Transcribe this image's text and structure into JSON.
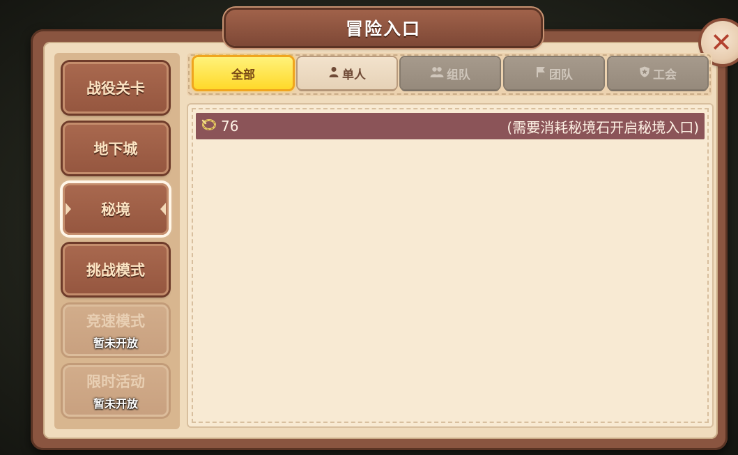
{
  "window": {
    "title": "冒险入口",
    "close_icon": "close-icon"
  },
  "sidebar": {
    "items": [
      {
        "label": "战役关卡",
        "state": "normal"
      },
      {
        "label": "地下城",
        "state": "normal"
      },
      {
        "label": "秘境",
        "state": "selected"
      },
      {
        "label": "挑战模式",
        "state": "normal"
      },
      {
        "label": "竞速模式",
        "sub": "暂未开放",
        "state": "disabled"
      },
      {
        "label": "限时活动",
        "sub": "暂未开放",
        "state": "disabled"
      }
    ]
  },
  "tabs": [
    {
      "label": "全部",
      "icon": "",
      "state": "selected"
    },
    {
      "label": "单人",
      "icon": "person-icon",
      "state": "normal"
    },
    {
      "label": "组队",
      "icon": "group-icon",
      "state": "disabled"
    },
    {
      "label": "团队",
      "icon": "flag-icon",
      "state": "disabled"
    },
    {
      "label": "工会",
      "icon": "shield-icon",
      "state": "disabled"
    }
  ],
  "entries": [
    {
      "icon": "ring-key-icon",
      "count": "76",
      "note": "(需要消耗秘境石开启秘境入口)"
    }
  ],
  "colors": {
    "frame": "#8a5540",
    "panel": "#f0dcbd",
    "active_tab": "#ffd92a",
    "row": "#8b5458"
  }
}
